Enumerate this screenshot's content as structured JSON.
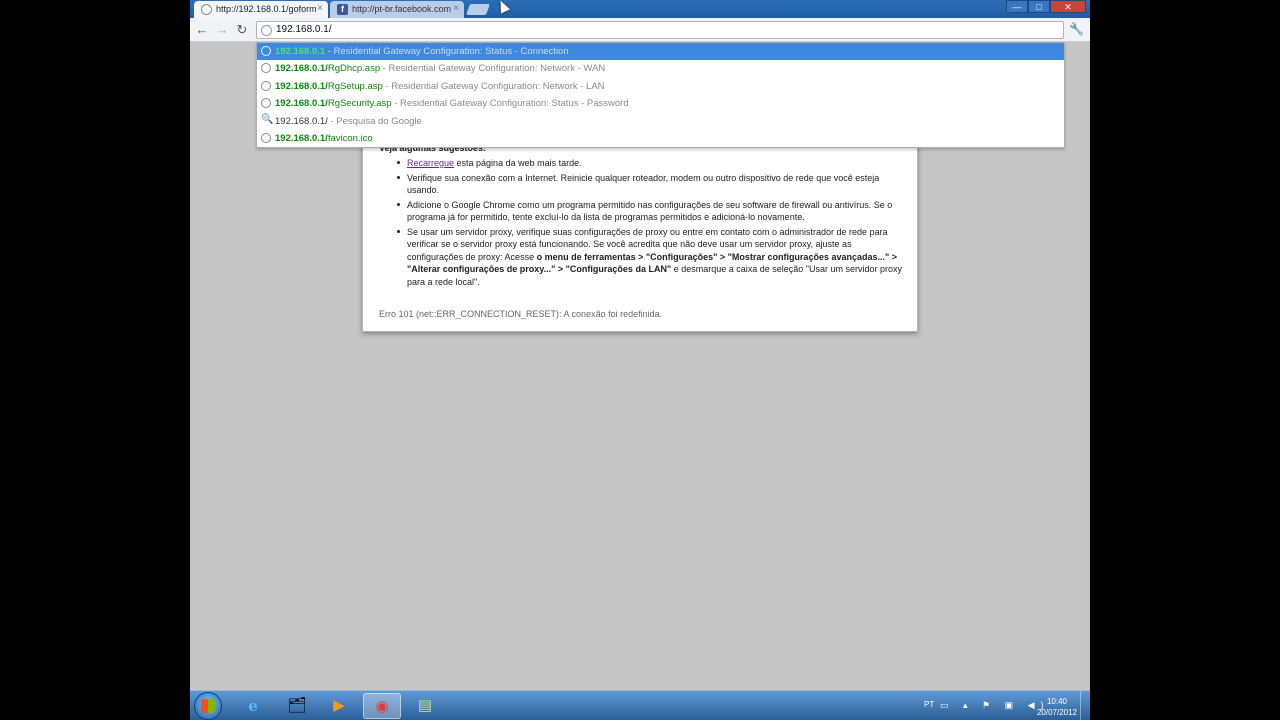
{
  "browser": {
    "tabs": [
      {
        "title": "http://192.168.0.1/goform",
        "close": "×"
      },
      {
        "title": "http://pt-br.facebook.com",
        "close": "×"
      }
    ],
    "window_controls": {
      "minimize": "—",
      "maximize": "□",
      "close": "✕"
    },
    "nav": {
      "back": "←",
      "forward": "→",
      "reload": "↻",
      "wrench": "🔧"
    },
    "omnibox_text": "192.168.0.1/"
  },
  "dropdown": {
    "items": [
      {
        "type": "history",
        "url_bold": "192.168.0.1",
        "url_rest": "",
        "desc": " - Residential Gateway Configuration: Status - Connection",
        "selected": true
      },
      {
        "type": "history",
        "url_bold": "192.168.0.1/",
        "url_rest": "RgDhcp.asp",
        "desc": " - Residential Gateway Configuration: Network - WAN"
      },
      {
        "type": "history",
        "url_bold": "192.168.0.1/",
        "url_rest": "RgSetup.asp",
        "desc": " - Residential Gateway Configuration: Network - LAN"
      },
      {
        "type": "history",
        "url_bold": "192.168.0.1/",
        "url_rest": "RgSecurity.asp",
        "desc": " - Residential Gateway Configuration: Status - Password"
      },
      {
        "type": "search",
        "text": "192.168.0.1/",
        "desc": " - Pesquisa do Google"
      },
      {
        "type": "history",
        "url_bold": "192.168.0.1/",
        "url_rest": "favicon.ico",
        "desc": ""
      }
    ]
  },
  "error_page": {
    "suggest_heading": "Veja algumas sugestões:",
    "suggestions": {
      "s1_link": "Recarregue",
      "s1_text": " esta página da web mais tarde.",
      "s2": "Verifique sua conexão com a Internet. Reinicie qualquer roteador, modem ou outro dispositivo de rede que você esteja usando.",
      "s3": "Adicione o Google Chrome como um programa permitido nas configurações de seu software de firewall ou antivírus. Se o programa já for permitido, tente excluí-lo da lista de programas permitidos e adicioná-lo novamente.",
      "s4_a": "Se usar um servidor proxy, verifique suas configurações de proxy ou entre em contato com o administrador de rede para verificar se o servidor proxy está funcionando. Se você acredita que não deve usar um servidor proxy, ajuste as configurações de proxy: Acesse ",
      "s4_b": "o menu de ferramentas > \"Configurações\" > \"Mostrar configurações avançadas...\" > \"Alterar configurações de proxy...\" > \"Configurações da LAN\"",
      "s4_c": " e desmarque a caixa de seleção \"Usar um servidor proxy para a rede local\"."
    },
    "error_code": "Erro 101 (net::ERR_CONNECTION_RESET): A conexão foi redefinida."
  },
  "taskbar": {
    "apps": [
      {
        "name": "internet-explorer",
        "glyph": "e"
      },
      {
        "name": "file-explorer",
        "glyph": "🗂"
      },
      {
        "name": "media-player",
        "glyph": "▶"
      },
      {
        "name": "chrome",
        "glyph": "◉"
      },
      {
        "name": "notes",
        "glyph": "▤"
      }
    ],
    "language": "PT",
    "time": "10:40",
    "date": "20/07/2012"
  },
  "colors": {
    "accent_selected": "#3d89e0",
    "url_green": "#0b8a0b",
    "taskbar": "#2b5f99"
  }
}
